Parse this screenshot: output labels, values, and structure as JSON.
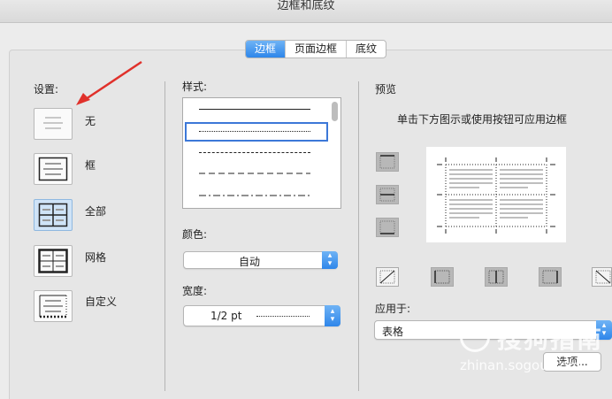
{
  "window": {
    "title": "边框和底纹"
  },
  "tabs": [
    {
      "label": "边框",
      "active": true
    },
    {
      "label": "页面边框",
      "active": false
    },
    {
      "label": "底纹",
      "active": false
    }
  ],
  "settings": {
    "heading": "设置:",
    "items": [
      {
        "label": "无",
        "icon": "border-none-icon",
        "selected": false
      },
      {
        "label": "框",
        "icon": "border-box-icon",
        "selected": false
      },
      {
        "label": "全部",
        "icon": "border-all-icon",
        "selected": true
      },
      {
        "label": "网格",
        "icon": "border-grid-icon",
        "selected": false
      },
      {
        "label": "自定义",
        "icon": "border-custom-icon",
        "selected": false
      }
    ]
  },
  "style": {
    "heading": "样式:",
    "options": [
      "solid",
      "dotted",
      "dashed",
      "dashed-long",
      "dash-dot"
    ],
    "selected_option": "dotted"
  },
  "color": {
    "heading": "颜色:",
    "value": "自动"
  },
  "width": {
    "heading": "宽度:",
    "value": "1/2 pt"
  },
  "preview": {
    "heading": "预览",
    "hint": "单击下方图示或使用按钮可应用边框"
  },
  "apply_to": {
    "heading": "应用于:",
    "value": "表格"
  },
  "options_button": {
    "label": "选项..."
  },
  "watermark": {
    "text": "搜狗指南",
    "url": "zhinan.sogou.com"
  },
  "colors": {
    "accent": "#2e86ea",
    "arrow": "#e0312b"
  }
}
